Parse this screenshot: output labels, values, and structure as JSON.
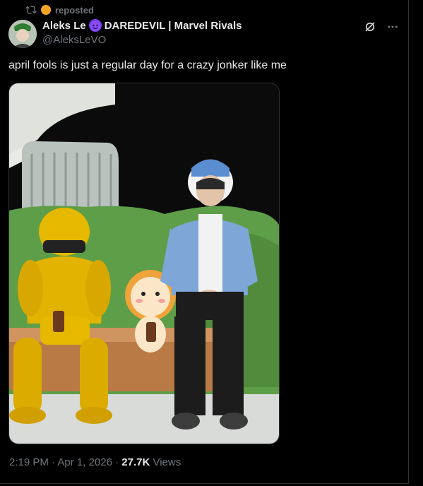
{
  "repost": {
    "label": "reposted",
    "icon": "repost-icon"
  },
  "author": {
    "display_name": "Aleks Le",
    "display_name_suffix": "DAREDEVIL | Marvel Rivals",
    "handle": "@AleksLeVO",
    "emoji_icon": "devil-emoji-icon"
  },
  "post": {
    "text": "april fools is just a regular day for a crazy jonker like me"
  },
  "meta": {
    "time": "2:19 PM",
    "sep1": " · ",
    "date": "Apr 1, 2026",
    "sep2": " · ",
    "views_count": "27.7K",
    "views_label": " Views"
  },
  "colors": {
    "background": "#000000",
    "text": "#e7e9ea",
    "muted": "#71767b",
    "border": "#2f3336"
  }
}
